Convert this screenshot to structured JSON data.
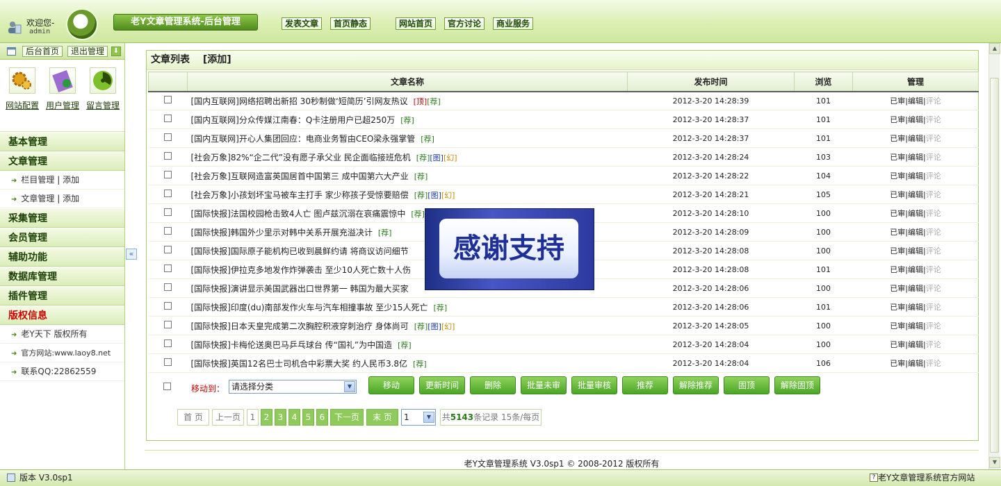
{
  "header": {
    "welcome": "欢迎您-",
    "username": "admin",
    "title": "老Y文章管理系统-后台管理",
    "links": [
      "发表文章",
      "首页静态",
      "网站首页",
      "官方讨论",
      "商业服务"
    ]
  },
  "sidebar": {
    "home": "后台首页",
    "logout": "退出管理",
    "quick": [
      "网站配置",
      "用户管理",
      "留言管理"
    ],
    "cats": [
      "基本管理",
      "文章管理",
      "采集管理",
      "会员管理",
      "辅助功能",
      "数据库管理",
      "插件管理",
      "版权信息"
    ],
    "article_subs": [
      {
        "label": "栏目管理",
        "add": "添加"
      },
      {
        "label": "文章管理",
        "add": "添加"
      }
    ],
    "copyright_subs": [
      "老Y天下 版权所有",
      "官方网站:www.laoy8.net",
      "联系QQ:22862559"
    ],
    "collapse": "«"
  },
  "main": {
    "title": "文章列表",
    "add": "[添加]",
    "columns": [
      "文章名称",
      "发布时间",
      "浏览",
      "管理"
    ],
    "rows": [
      {
        "title": "[国内互联网]网络招聘出新招 30秒制做‘短简历’引网友热议",
        "tags": [
          {
            "t": "[顶]",
            "c": "#c00000"
          },
          {
            "t": "[荐]",
            "c": "#2a7a1a"
          }
        ],
        "time": "2012-3-20 14:28:39",
        "views": "101"
      },
      {
        "title": "[国内互联网]分众传媒江南春：Q卡注册用户已超250万",
        "tags": [
          {
            "t": "[荐]",
            "c": "#2a7a1a"
          }
        ],
        "time": "2012-3-20 14:28:37",
        "views": "101"
      },
      {
        "title": "[国内互联网]开心人集团回应：电商业务暂由CEO梁永强掌管",
        "tags": [
          {
            "t": "[荐]",
            "c": "#2a7a1a"
          }
        ],
        "time": "2012-3-20 14:28:37",
        "views": "101"
      },
      {
        "title": "[社会万象]82%“企二代”没有愿子承父业 民企面临接班危机",
        "tags": [
          {
            "t": "[荐]",
            "c": "#2a7a1a"
          },
          {
            "t": "[图]",
            "c": "#1a3aa0"
          },
          {
            "t": "[幻]",
            "c": "#c68a00"
          }
        ],
        "time": "2012-3-20 14:28:24",
        "views": "103"
      },
      {
        "title": "[社会万象]互联网造富英国居首中国第三 成中国第六大产业",
        "tags": [
          {
            "t": "[荐]",
            "c": "#2a7a1a"
          }
        ],
        "time": "2012-3-20 14:28:22",
        "views": "104"
      },
      {
        "title": "[社会万象]小孩划坏宝马被车主打手 家少称孩子受惊要赔偿",
        "tags": [
          {
            "t": "[荐]",
            "c": "#2a7a1a"
          },
          {
            "t": "[图]",
            "c": "#1a3aa0"
          },
          {
            "t": "[幻]",
            "c": "#c68a00"
          }
        ],
        "time": "2012-3-20 14:28:21",
        "views": "105"
      },
      {
        "title": "[国际快报]法国校园枪击致4人亡 图卢兹沉溺在哀痛震惊中",
        "tags": [
          {
            "t": "[荐]",
            "c": "#2a7a1a"
          }
        ],
        "time": "2012-3-20 14:28:10",
        "views": "100"
      },
      {
        "title": "[国际快报]韩国外少里示对韩中关系开展充溢决计",
        "tags": [
          {
            "t": "[荐]",
            "c": "#2a7a1a"
          }
        ],
        "time": "2012-3-20 14:28:09",
        "views": "100"
      },
      {
        "title": "[国际快报]国际原子能机构已收到晨鲜约请 将商议访问细节",
        "tags": [],
        "time": "2012-3-20 14:28:08",
        "views": "100"
      },
      {
        "title": "[国际快报]伊拉克多地发作炸弹袭击 至少10人死亡数十人伤",
        "tags": [],
        "time": "2012-3-20 14:28:08",
        "views": "101"
      },
      {
        "title": "[国际快报]演讲显示美国武器出口世界第一 韩国为最大买家",
        "tags": [],
        "time": "2012-3-20 14:28:06",
        "views": "100"
      },
      {
        "title": "[国际快报]印度(du)南部发作火车与汽车相撞事故 至少15人死亡",
        "tags": [
          {
            "t": "[荐]",
            "c": "#2a7a1a"
          }
        ],
        "time": "2012-3-20 14:28:06",
        "views": "101"
      },
      {
        "title": "[国际快报]日本天皇完成第二次胸腔积液穿刺治疗 身体尚可",
        "tags": [
          {
            "t": "[荐]",
            "c": "#2a7a1a"
          },
          {
            "t": "[图]",
            "c": "#1a3aa0"
          },
          {
            "t": "[幻]",
            "c": "#c68a00"
          }
        ],
        "time": "2012-3-20 14:28:05",
        "views": "100"
      },
      {
        "title": "[国际快报]卡梅伦送奥巴马乒乓球台 传“国礼”为中国造",
        "tags": [
          {
            "t": "[荐]",
            "c": "#2a7a1a"
          }
        ],
        "time": "2012-3-20 14:28:04",
        "views": "100"
      },
      {
        "title": "[国际快报]英国12名巴士司机合中彩票大奖 约人民币3.8亿",
        "tags": [
          {
            "t": "[荐]",
            "c": "#2a7a1a"
          }
        ],
        "time": "2012-3-20 14:28:04",
        "views": "106"
      }
    ],
    "manage": {
      "audited": "已审",
      "edit": "编辑",
      "comment": "评论"
    },
    "move_label": "移动到：",
    "move_select": "请选择分类",
    "actions": [
      "移动",
      "更新时间",
      "删除",
      "批量未审",
      "批量审核",
      "推荐",
      "解除推荐",
      "固顶",
      "解除固顶"
    ],
    "pager": {
      "first": "首 页",
      "prev": "上一页",
      "pages": [
        "1",
        "2",
        "3",
        "4",
        "5",
        "6"
      ],
      "next": "下一页",
      "last": "末 页",
      "select": "1",
      "summary_pre": "共",
      "total": "5143",
      "summary_post": "条记录 15条/每页"
    },
    "footer": "老Y文章管理系统 V3.0sp1 © 2008-2012 版权所有"
  },
  "overlay": {
    "text": "感谢支持"
  },
  "status": {
    "version": "版本 V3.0sp1",
    "site": "老Y文章管理系统官方网站"
  }
}
